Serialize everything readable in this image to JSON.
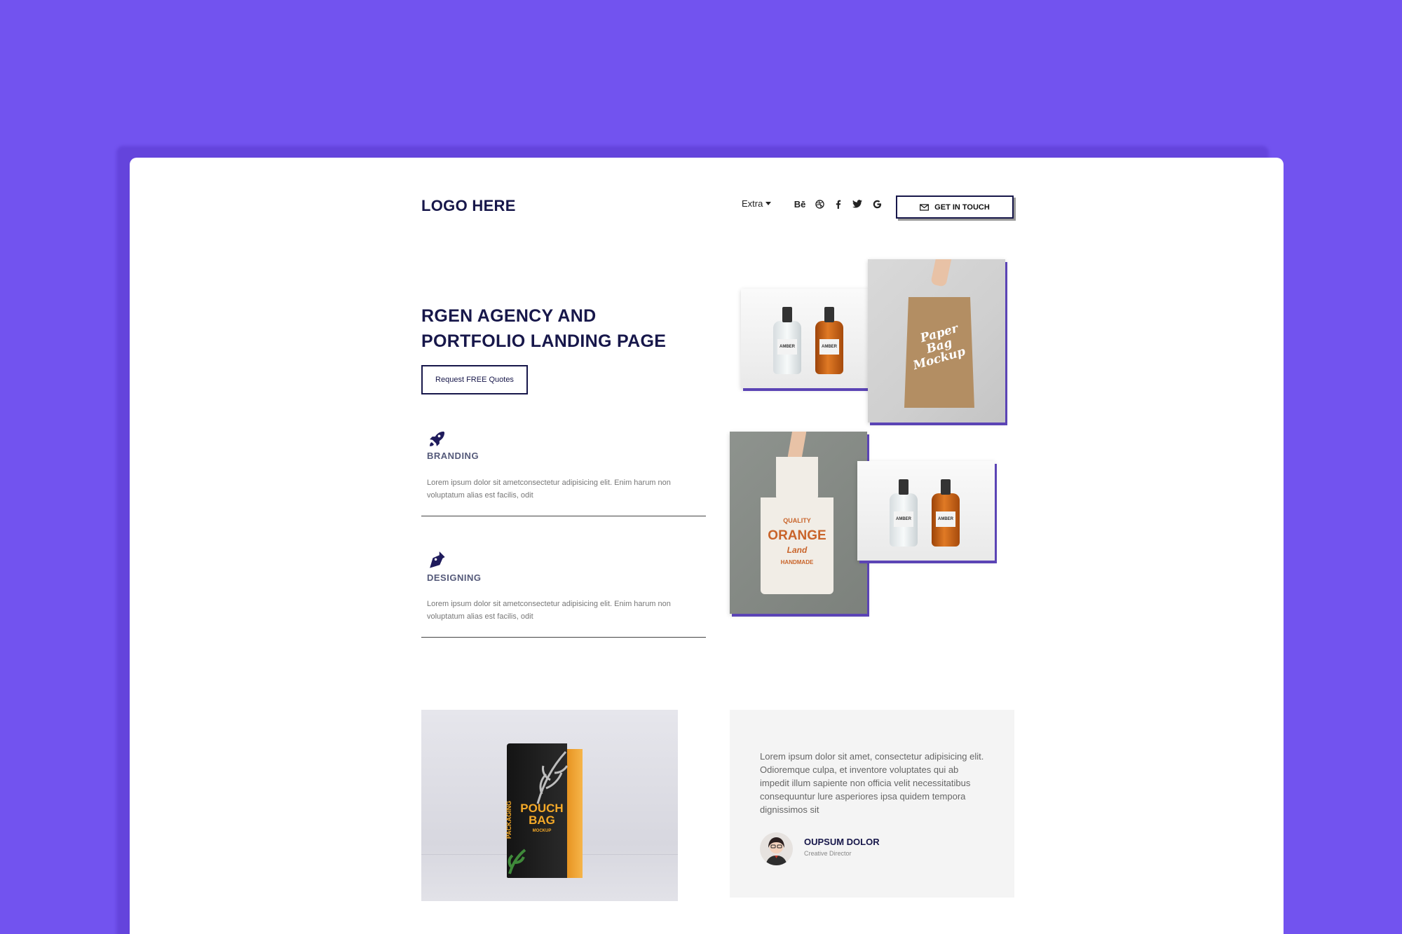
{
  "header": {
    "logo": "LOGO HERE",
    "menu_extra": "Extra",
    "social_behance": "Bē",
    "cta_label": "GET IN TOUCH"
  },
  "hero": {
    "title_line1": "RGEN AGENCY AND",
    "title_line2": "PORTFOLIO LANDING PAGE",
    "button_label": "Request FREE Quotes"
  },
  "services": [
    {
      "title": "BRANDING",
      "text": "Lorem ipsum dolor sit ametconsectetur adipisicing elit. Enim harum non voluptatum alias est facilis, odit",
      "icon": "rocket-icon"
    },
    {
      "title": "DESIGNING",
      "text": "Lorem ipsum dolor sit ametconsectetur adipisicing elit. Enim harum non voluptatum alias est facilis, odit",
      "icon": "pen-nib-icon"
    }
  ],
  "gallery": {
    "bottle_label": "AMBER",
    "paper_bag_text": [
      "Paper",
      "Bag",
      "Mockup"
    ],
    "tote_text_top": "QUALITY",
    "tote_text_main": "ORANGE",
    "tote_text_sub": "Land",
    "tote_text_bottom": "HANDMADE"
  },
  "pouch": {
    "title": "POUCH BAG",
    "sub": "MOCKUP",
    "side_text": "PACKAGING"
  },
  "testimonial": {
    "text": "Lorem ipsum dolor sit amet, consectetur adipisicing elit. Odioremque culpa, et inventore voluptates qui ab impedit illum sapiente non officia velit necessitatibus consequuntur lure asperiores ipsa quidem tempora dignissimos sit",
    "name": "OUPSUM DOLOR",
    "role": "Creative Director"
  },
  "colors": {
    "background": "#7253ef",
    "navy": "#17174a",
    "accent_shadow": "#5b44b5"
  }
}
